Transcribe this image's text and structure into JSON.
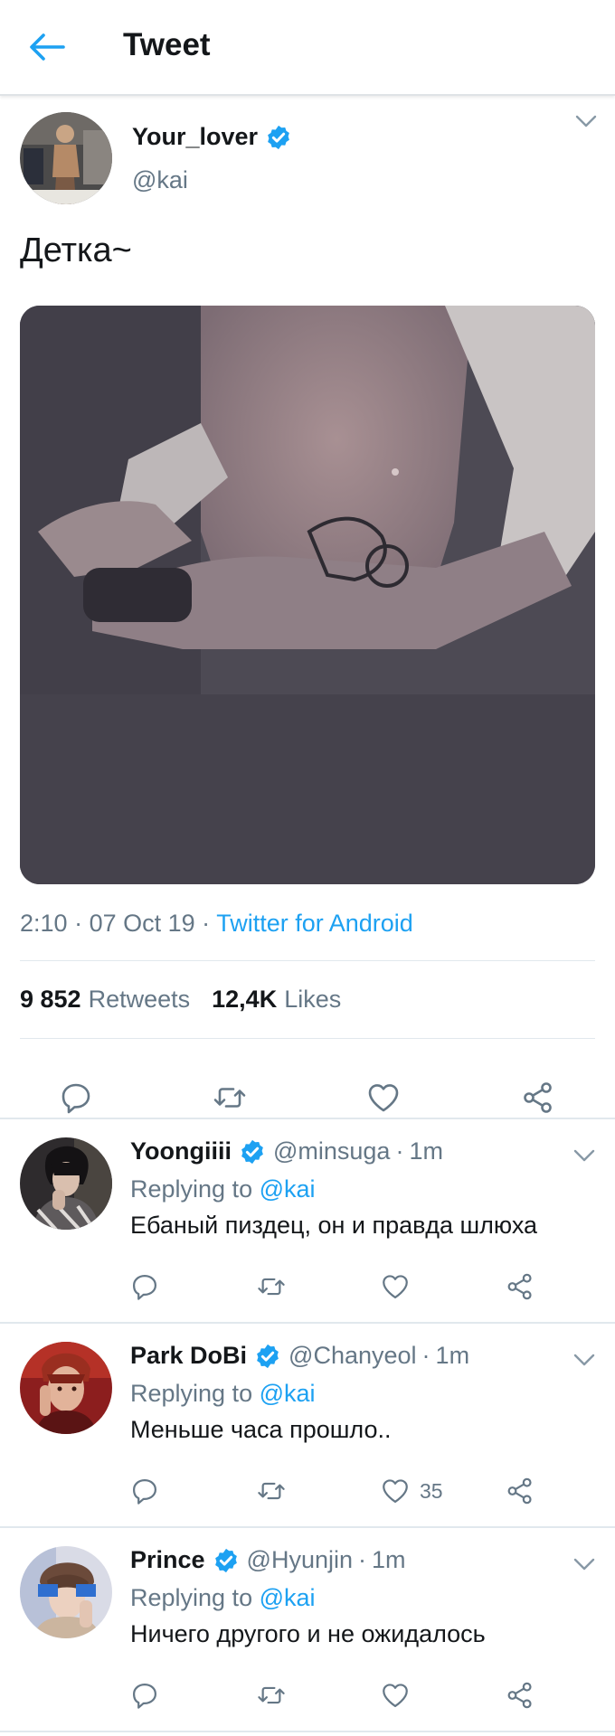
{
  "header": {
    "title": "Tweet"
  },
  "tweet": {
    "name": "Your_lover",
    "handle": "@kai",
    "text": "Детка~",
    "time": "2:10",
    "date": "07 Oct 19",
    "source": "Twitter for Android",
    "retweets_count": "9 852",
    "retweets_label": "Retweets",
    "likes_count": "12,4K",
    "likes_label": "Likes"
  },
  "replies": [
    {
      "name": "Yoongiiii",
      "handle": "@minsuga",
      "time": "1m",
      "replying_label": "Replying to",
      "replying_to": "@kai",
      "text": "Ебаный пиздец, он и правда шлюха",
      "likes": ""
    },
    {
      "name": "Park DoBi",
      "handle": "@Chanyeol",
      "time": "1m",
      "replying_label": "Replying to",
      "replying_to": "@kai",
      "text": "Меньше часа прошло..",
      "likes": "35"
    },
    {
      "name": "Prince",
      "handle": "@Hyunjin",
      "time": "1m",
      "replying_label": "Replying to",
      "replying_to": "@kai",
      "text": "Ничего другого и не ожидалось",
      "likes": ""
    }
  ],
  "icons": {
    "back": "arrow-left-icon",
    "verified": "verified-badge-icon",
    "caret": "chevron-down-icon",
    "reply": "reply-icon",
    "retweet": "retweet-icon",
    "like": "heart-icon",
    "share": "share-icon"
  },
  "colors": {
    "accent": "#1da1f2",
    "text": "#14171a",
    "secondary": "#657786",
    "divider": "#e1e8ed"
  }
}
